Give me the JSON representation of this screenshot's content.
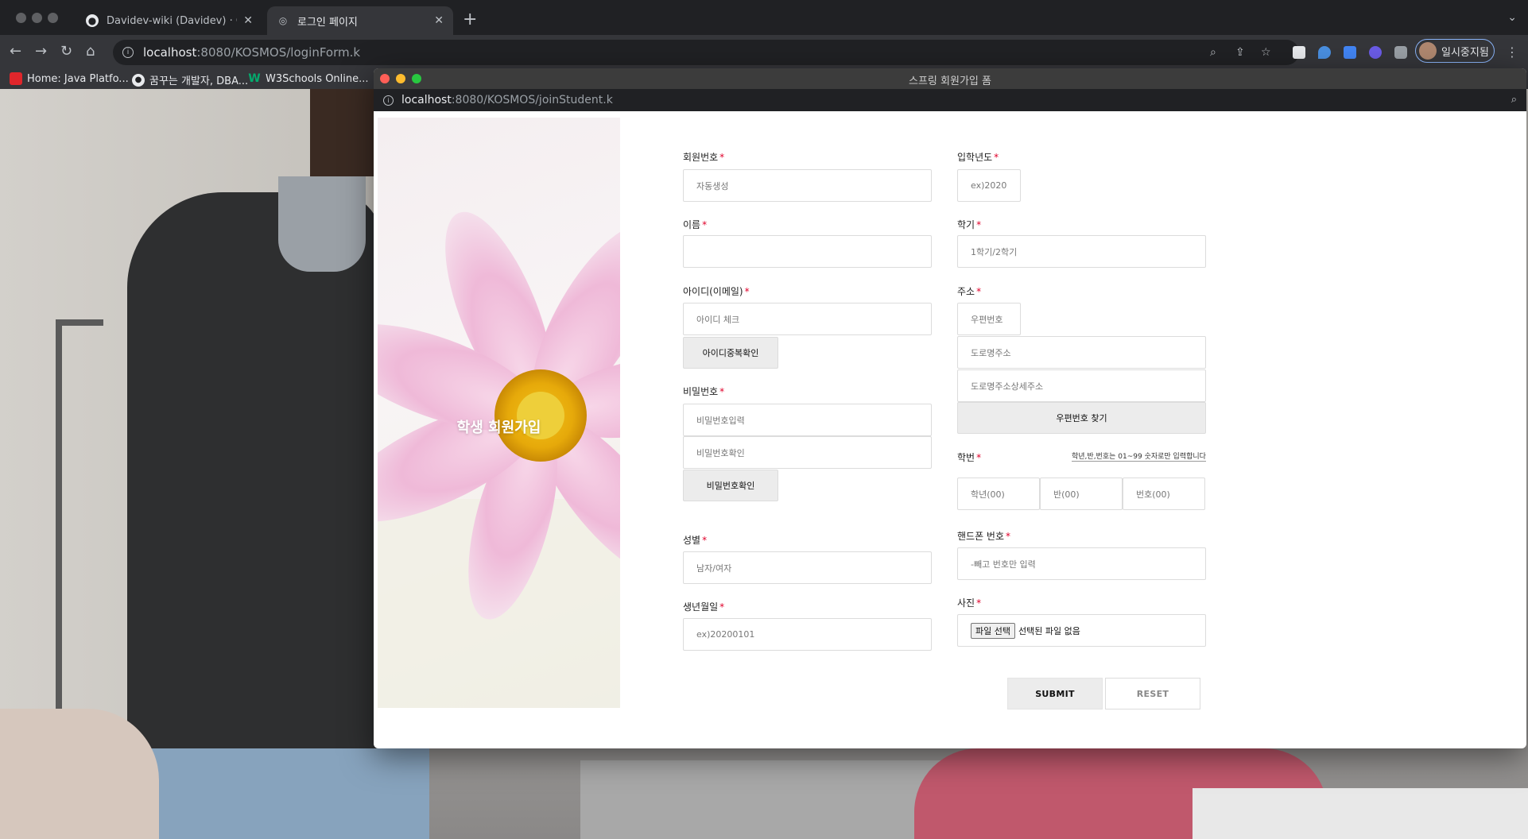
{
  "browser": {
    "tabs": [
      {
        "title": "Davidev-wiki (Davidev) · GitHub",
        "icon": "github-icon",
        "active": false
      },
      {
        "title": "로그인 페이지",
        "icon": "globe-icon",
        "active": true
      }
    ],
    "url_host": "localhost",
    "url_rest": ":8080/KOSMOS/loginForm.k",
    "profile_label": "일시중지됨",
    "bookmarks": [
      {
        "label": "Home: Java Platfo...",
        "icon": "oracle-icon",
        "color": "#e0262b"
      },
      {
        "label": "꿈꾸는 개발자, DBA...",
        "icon": "globe-icon",
        "color": "#e8eaed"
      },
      {
        "label": "W3Schools Online...",
        "icon": "w3schools-icon",
        "color": "#04aa6d"
      }
    ]
  },
  "popup": {
    "title": "스프링 회원가입 폼",
    "url_host": "localhost",
    "url_rest": ":8080/KOSMOS/joinStudent.k",
    "side_title": "학생 회원가입"
  },
  "form": {
    "member_no": {
      "label": "회원번호",
      "placeholder": "자동생성"
    },
    "name": {
      "label": "이름",
      "placeholder": ""
    },
    "user_id": {
      "label": "아이디(이메일)",
      "placeholder": "아이디 체크",
      "button": "아이디중복확인"
    },
    "password": {
      "label": "비밀번호",
      "placeholder": "비밀번호입력",
      "confirm_placeholder": "비밀번호확인",
      "button": "비밀번호확인"
    },
    "gender": {
      "label": "성별",
      "placeholder": "남자/여자"
    },
    "birth": {
      "label": "생년월일",
      "placeholder": "ex)20200101"
    },
    "entry_year": {
      "label": "입학년도",
      "placeholder": "ex)2020"
    },
    "semester": {
      "label": "학기",
      "placeholder": "1학기/2학기"
    },
    "address": {
      "label": "주소",
      "zip_placeholder": "우편번호",
      "road_placeholder": "도로명주소",
      "detail_placeholder": "도로명주소상세주소",
      "button": "우편번호 찾기"
    },
    "student_no": {
      "label": "학번",
      "hint": "학년,반,번호는 01~99 숫자로만 입력합니다",
      "grade_placeholder": "학년(00)",
      "class_placeholder": "반(00)",
      "number_placeholder": "번호(00)"
    },
    "phone": {
      "label": "핸드폰 번호",
      "placeholder": "-빼고 번호만 입력"
    },
    "photo": {
      "label": "사진",
      "file_button": "파일 선택",
      "file_status": "선택된 파일 없음"
    },
    "required_mark": "*",
    "submit": "SUBMIT",
    "reset": "RESET"
  },
  "colors": {
    "required": "#e0002a",
    "input_border": "#dcdcdc",
    "button_bg": "#ececec"
  }
}
